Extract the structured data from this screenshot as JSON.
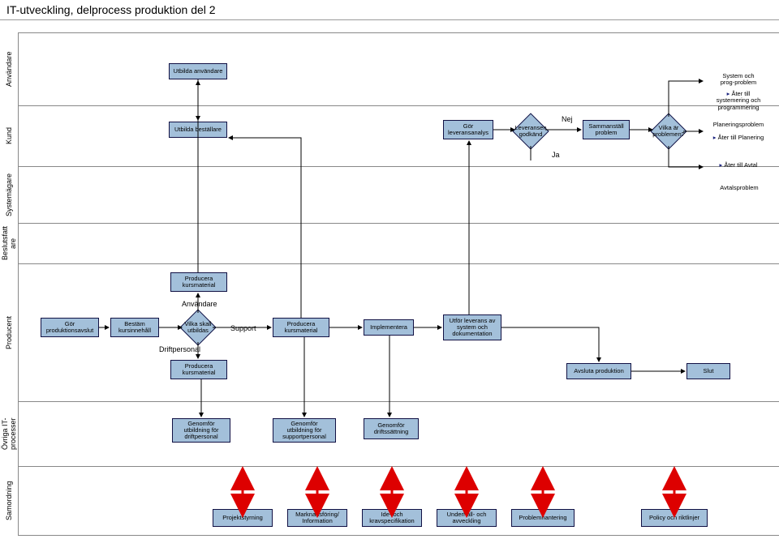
{
  "title": "IT-utveckling, delprocess produktion del 2",
  "lanes": {
    "anvandare": "Användare",
    "kund": "Kund",
    "systemagare": "Systemägare",
    "beslutsfattare": "Beslutsfatt\nare",
    "producent": "Producent",
    "ovriga": "Övriga IT-\nprocesser",
    "samordning": "Samordning"
  },
  "kund": {
    "utbilda_anvandare": "Utbilda användare",
    "utbilda_bestallare": "Utbilda beställare",
    "leveransanalys": "Gör\nleveransanalys",
    "leveransen_godkand": "Leveransen\ngodkänd",
    "nej": "Nej",
    "ja": "Ja",
    "sammanstall": "Sammanställ\nproblem",
    "vilka_ar": "Vilka är\nproblemen?",
    "system_prog": "System och\nprog-problem",
    "ater_systemering": "Åter till\nsystemering och\nprogrammering",
    "planeringsproblem": "Planeringsproblem",
    "ater_planering": "Åter till Planering",
    "ater_avtal": "Åter till Avtal",
    "avtalsproblem": "Avtalsproblem"
  },
  "producent": {
    "gor_prodavslut": "Gör\nproduktionsavslut",
    "bestam": "Bestäm\nkursinnehåll",
    "vilka_skall": "Vilka skall\nutbildas",
    "support": "Support",
    "producera_km": "Producera\nkursmaterial",
    "implementera": "Implementera",
    "utfor_leverans": "Utför leverans av\nsystem och\ndokumentation",
    "avsluta_prod": "Avsluta produktion",
    "slut": "Slut",
    "anvandare_lbl": "Användare",
    "driftpersonal_lbl": "Driftpersonal"
  },
  "ovriga": {
    "genomfor_drift": "Genomför\nutbildning för\ndriftpersonal",
    "genomfor_support": "Genomför\nutbildning för\nsupportpersonal",
    "genomfor_driftsatt": "Genomför\ndriftssättning"
  },
  "samordning": {
    "projektstyrning": "Projektstyrning",
    "marknadsforing": "Marknadsföring/\nInformation",
    "ide_krav": "Ide- och\nkravspecifikation",
    "underhall": "Underhåll- och\navveckling",
    "problemhantering": "Problemhantering",
    "policy": "Policy och riktlinjer"
  },
  "chart_data": {
    "type": "table",
    "description": "Swimlane process flow diagram with 7 lanes",
    "lanes": [
      "Användare",
      "Kund",
      "Systemägare",
      "Beslutsfattare",
      "Producent",
      "Övriga IT-processer",
      "Samordning"
    ],
    "nodes": [
      {
        "id": "utbilda_anv",
        "lane": "Användare",
        "label": "Utbilda användare",
        "type": "process"
      },
      {
        "id": "utbilda_best",
        "lane": "Kund",
        "label": "Utbilda beställare",
        "type": "process"
      },
      {
        "id": "lev_analys",
        "lane": "Kund",
        "label": "Gör leveransanalys",
        "type": "process"
      },
      {
        "id": "lev_godk",
        "lane": "Kund",
        "label": "Leveransen godkänd",
        "type": "decision"
      },
      {
        "id": "sammanst",
        "lane": "Kund",
        "label": "Sammanställ problem",
        "type": "process"
      },
      {
        "id": "vilka_prob",
        "lane": "Kund",
        "label": "Vilka är problemen?",
        "type": "decision"
      },
      {
        "id": "sys_prog",
        "lane": "Kund",
        "label": "System och prog-problem",
        "type": "text"
      },
      {
        "id": "ater_sys",
        "lane": "Kund",
        "label": "Åter till systemering och programmering",
        "type": "text"
      },
      {
        "id": "planeringsp",
        "lane": "Kund",
        "label": "Planeringsproblem",
        "type": "text"
      },
      {
        "id": "ater_plan",
        "lane": "Kund",
        "label": "Åter till Planering",
        "type": "text"
      },
      {
        "id": "ater_avtal",
        "lane": "Kund",
        "label": "Åter till Avtal",
        "type": "text"
      },
      {
        "id": "avtalsp",
        "lane": "Systemägare",
        "label": "Avtalsproblem",
        "type": "text"
      },
      {
        "id": "prod_avsl",
        "lane": "Producent",
        "label": "Gör produktionsavslut",
        "type": "process"
      },
      {
        "id": "best_kurs",
        "lane": "Producent",
        "label": "Bestäm kursinnehåll",
        "type": "process"
      },
      {
        "id": "vilka_utb",
        "lane": "Producent",
        "label": "Vilka skall utbildas",
        "type": "decision"
      },
      {
        "id": "support",
        "lane": "Producent",
        "label": "Support",
        "type": "text"
      },
      {
        "id": "prod_km1",
        "lane": "Producent",
        "label": "Producera kursmaterial",
        "type": "process"
      },
      {
        "id": "prod_km2",
        "lane": "Producent",
        "label": "Producera kursmaterial",
        "type": "process"
      },
      {
        "id": "prod_km3",
        "lane": "Producent",
        "label": "Producera kursmaterial",
        "type": "process"
      },
      {
        "id": "impl",
        "lane": "Producent",
        "label": "Implementera",
        "type": "process"
      },
      {
        "id": "utfor_lev",
        "lane": "Producent",
        "label": "Utför leverans av system och dokumentation",
        "type": "process"
      },
      {
        "id": "avsl_prod",
        "lane": "Producent",
        "label": "Avsluta produktion",
        "type": "process"
      },
      {
        "id": "slut",
        "lane": "Producent",
        "label": "Slut",
        "type": "process"
      },
      {
        "id": "gen_drift",
        "lane": "Övriga IT-processer",
        "label": "Genomför utbildning för driftpersonal",
        "type": "process"
      },
      {
        "id": "gen_supp",
        "lane": "Övriga IT-processer",
        "label": "Genomför utbildning för supportpersonal",
        "type": "process"
      },
      {
        "id": "gen_ds",
        "lane": "Övriga IT-processer",
        "label": "Genomför driftssättning",
        "type": "process"
      },
      {
        "id": "ps",
        "lane": "Samordning",
        "label": "Projektstyrning",
        "type": "process"
      },
      {
        "id": "mi",
        "lane": "Samordning",
        "label": "Marknadsföring/Information",
        "type": "process"
      },
      {
        "id": "ik",
        "lane": "Samordning",
        "label": "Ide- och kravspecifikation",
        "type": "process"
      },
      {
        "id": "ua",
        "lane": "Samordning",
        "label": "Underhåll- och avveckling",
        "type": "process"
      },
      {
        "id": "ph",
        "lane": "Samordning",
        "label": "Problemhantering",
        "type": "process"
      },
      {
        "id": "pr",
        "lane": "Samordning",
        "label": "Policy och riktlinjer",
        "type": "process"
      }
    ],
    "edges": [
      {
        "from": "prod_avsl",
        "to": "best_kurs"
      },
      {
        "from": "best_kurs",
        "to": "vilka_utb"
      },
      {
        "from": "vilka_utb",
        "to": "prod_km1",
        "label": "Användare"
      },
      {
        "from": "vilka_utb",
        "to": "prod_km2",
        "label": "Support"
      },
      {
        "from": "vilka_utb",
        "to": "prod_km3",
        "label": "Driftpersonal"
      },
      {
        "from": "prod_km1",
        "to": "utbilda_anv"
      },
      {
        "from": "prod_km2",
        "to": "impl"
      },
      {
        "from": "prod_km3",
        "to": "gen_drift"
      },
      {
        "from": "impl",
        "to": "utfor_lev"
      },
      {
        "from": "impl",
        "to": "gen_ds"
      },
      {
        "from": "utfor_lev",
        "to": "lev_analys"
      },
      {
        "from": "utfor_lev",
        "to": "avsl_prod"
      },
      {
        "from": "lev_analys",
        "to": "lev_godk"
      },
      {
        "from": "lev_godk",
        "to": "sammanst",
        "label": "Nej"
      },
      {
        "from": "lev_godk",
        "to": "prod_avsl",
        "label": "Ja"
      },
      {
        "from": "sammanst",
        "to": "vilka_prob"
      },
      {
        "from": "avsl_prod",
        "to": "slut"
      },
      {
        "from": "utbilda_anv",
        "to": "utbilda_best"
      },
      {
        "from": "utbilda_best",
        "to": "gen_supp"
      }
    ]
  }
}
